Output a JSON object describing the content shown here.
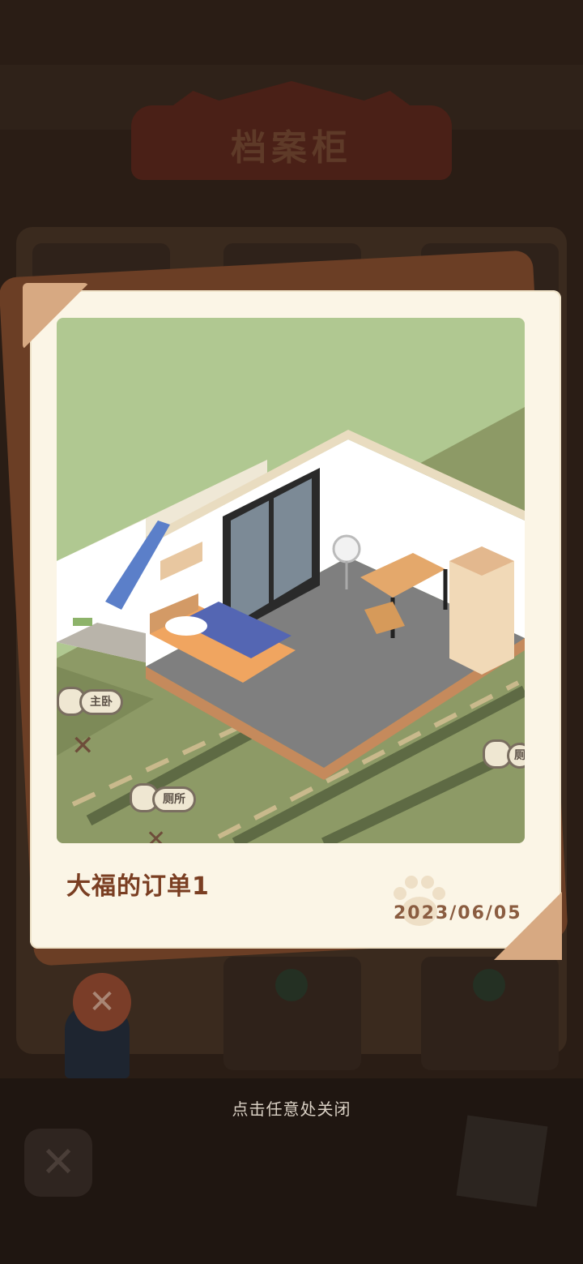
{
  "background": {
    "title": "档案柜",
    "close_glyph": "✕"
  },
  "card": {
    "order_title": "大福的订单1",
    "date": "2023/06/05",
    "photo": {
      "labels": {
        "master_bedroom": "主卧",
        "toilet": "厕所",
        "toilet_right": "厕"
      },
      "markers": [
        "✕",
        "✕"
      ]
    }
  },
  "hint": "点击任意处关闭",
  "colors": {
    "card": "#fbf5e6",
    "photo_bg": "#b0c891",
    "title": "#7a3e22",
    "date": "#8a5c40"
  }
}
